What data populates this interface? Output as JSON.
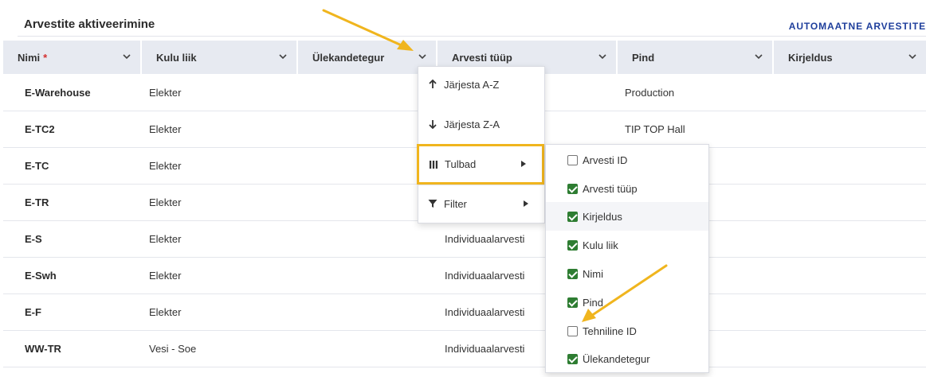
{
  "page": {
    "title": "Arvestite aktiveerimine",
    "action_button": "AUTOMAATNE ARVESTITE"
  },
  "columns": [
    {
      "label": "Nimi",
      "required_mark": "*"
    },
    {
      "label": "Kulu liik"
    },
    {
      "label": "Ülekandetegur"
    },
    {
      "label": "Arvesti tüüp"
    },
    {
      "label": "Pind"
    },
    {
      "label": "Kirjeldus"
    }
  ],
  "rows": [
    {
      "name": "E-Warehouse",
      "cost_type": "Elekter",
      "meter_type": "",
      "area": "Production"
    },
    {
      "name": "E-TC2",
      "cost_type": "Elekter",
      "meter_type": "",
      "area": "TIP TOP Hall"
    },
    {
      "name": "E-TC",
      "cost_type": "Elekter",
      "meter_type": "",
      "area": ""
    },
    {
      "name": "E-TR",
      "cost_type": "Elekter",
      "meter_type": "",
      "area": ""
    },
    {
      "name": "E-S",
      "cost_type": "Elekter",
      "meter_type": "Individuaalarvesti",
      "area": ""
    },
    {
      "name": "E-Swh",
      "cost_type": "Elekter",
      "meter_type": "Individuaalarvesti",
      "area": ""
    },
    {
      "name": "E-F",
      "cost_type": "Elekter",
      "meter_type": "Individuaalarvesti",
      "area": ""
    },
    {
      "name": "WW-TR",
      "cost_type": "Vesi - Soe",
      "meter_type": "Individuaalarvesti",
      "area": ""
    }
  ],
  "column_menu": {
    "sort_asc": "Järjesta A-Z",
    "sort_desc": "Järjesta Z-A",
    "columns": "Tulbad",
    "filter": "Filter"
  },
  "columns_submenu": [
    {
      "label": "Arvesti ID",
      "checked": false
    },
    {
      "label": "Arvesti tüüp",
      "checked": true
    },
    {
      "label": "Kirjeldus",
      "checked": true
    },
    {
      "label": "Kulu liik",
      "checked": true
    },
    {
      "label": "Nimi",
      "checked": true
    },
    {
      "label": "Pind",
      "checked": true
    },
    {
      "label": "Tehniline ID",
      "checked": false
    },
    {
      "label": "Ülekandetegur",
      "checked": true
    }
  ],
  "colors": {
    "accent_link": "#1f3f9c",
    "header_bg": "#e7eaf1",
    "checkbox_on": "#2e7d32",
    "annotation": "#f0b51e"
  },
  "icons": {
    "column_dropdown": "chevron-down-icon",
    "sort_asc": "arrow-up-icon",
    "sort_desc": "arrow-down-icon",
    "columns": "columns-icon",
    "filter": "filter-icon",
    "submenu": "caret-right-icon"
  }
}
